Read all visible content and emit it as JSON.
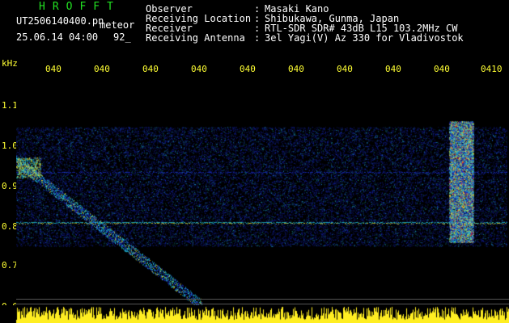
{
  "header": {
    "logo": "HROFFT",
    "filename": "UT2506140400.pn",
    "mode": "meteor",
    "datetime": "25.06.14 04:00",
    "count": "92_"
  },
  "station_info": [
    {
      "label": "Observer",
      "value": "Masaki Kano"
    },
    {
      "label": "Receiving Location",
      "value": "Shibukawa, Gunma, Japan"
    },
    {
      "label": "Receiver",
      "value": "RTL-SDR SDR# 43dB L15 103.2MHz CW"
    },
    {
      "label": "Receiving Antenna",
      "value": "3el Yagi(V) Az 330 for Vladivostok"
    }
  ],
  "axis": {
    "y_unit": "kHz",
    "y_ticks": [
      "1.1",
      "1.0",
      "0.9",
      "0.8",
      "0.7",
      "0.6"
    ],
    "x_ticks": [
      "040",
      "040",
      "040",
      "040",
      "040",
      "040",
      "040",
      "040",
      "040",
      "0410"
    ]
  },
  "colors": {
    "label": "#ffffff",
    "logo": "#22e022",
    "axis": "#ffff33",
    "background": "#000000",
    "signal_low": "#1a2ccc",
    "signal_mid": "#22d0e0",
    "signal_high": "#ffee22",
    "signal_peak": "#ff2222"
  }
}
